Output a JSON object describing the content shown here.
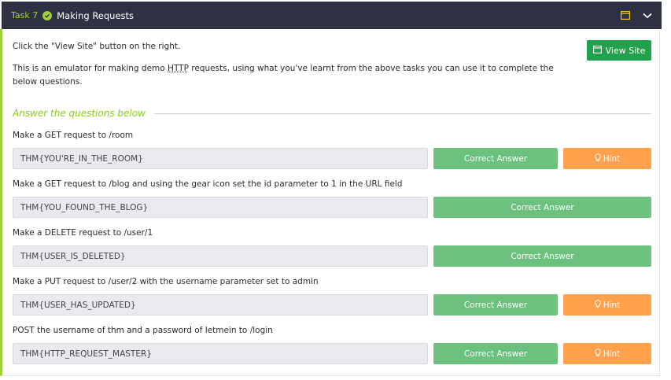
{
  "task": {
    "number": "Task 7",
    "title": "Making Requests"
  },
  "intro": {
    "line1": "Click the \"View Site\" button on the right.",
    "line2_before": "This is an emulator for making demo ",
    "line2_abbr": "HTTP",
    "line2_after": " requests, using what you've learnt from the above tasks you can use it to complete the below questions."
  },
  "view_site_label": "View Site",
  "section_title": "Answer the questions below",
  "questions": [
    {
      "label": "Make a GET request to /room",
      "answer": "THM{YOU'RE_IN_THE_ROOM}",
      "button": "Correct Answer",
      "hint": "Hint"
    },
    {
      "label": "Make a GET request to /blog and using the gear icon set the id parameter to 1 in the URL field",
      "answer": "THM{YOU_FOUND_THE_BLOG}",
      "button": "Correct Answer"
    },
    {
      "label": "Make a DELETE request to /user/1",
      "answer": "THM{USER_IS_DELETED}",
      "button": "Correct Answer"
    },
    {
      "label": "Make a PUT request to /user/2 with the username parameter set to admin",
      "answer": "THM{USER_HAS_UPDATED}",
      "button": "Correct Answer",
      "hint": "Hint"
    },
    {
      "label": "POST the username of thm and a password of letmein to /login",
      "answer": "THM{HTTP_REQUEST_MASTER}",
      "button": "Correct Answer",
      "hint": "Hint"
    }
  ],
  "colors": {
    "header_bg": "#2d3142",
    "accent_green": "#9dd03a",
    "correct_green": "#6cc17e",
    "hint_orange": "#ffa04a",
    "view_site_green": "#23a24d"
  }
}
